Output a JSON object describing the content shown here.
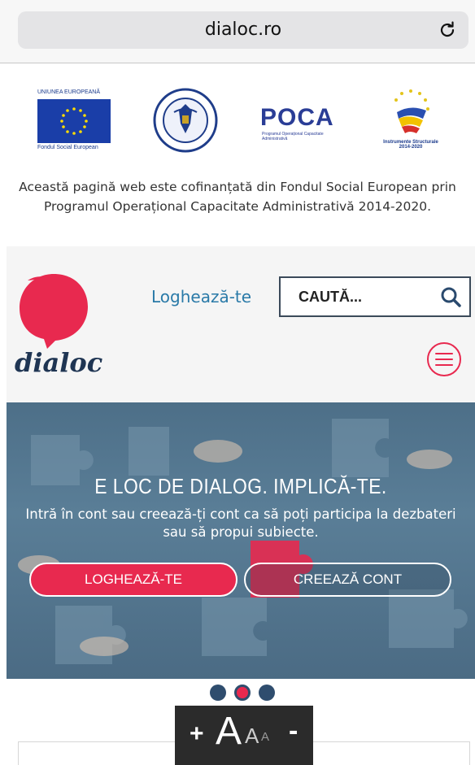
{
  "browser": {
    "url": "dialoc.ro",
    "reload_icon": "reload-icon"
  },
  "partners": {
    "eu_caption_top": "UNIUNEA EUROPEANĂ",
    "eu_caption_bottom": "Fondul Social European",
    "gov_ring_text": "GUVERNUL ROMÂNIEI",
    "poca_title": "POCA",
    "poca_subtitle": "Programul Operațional Capacitate Administrativă",
    "is_caption": "Instrumente Structurale 2014-2020",
    "cofinance_note": "Această pagină web este cofinanțată din Fondul Social European prin Programul Operațional Capacitate Administrativă 2014-2020."
  },
  "header": {
    "brand_text": "dialoc",
    "login_link": "Loghează-te",
    "search_placeholder": "CAUTĂ..."
  },
  "hero": {
    "title": "E LOC DE DIALOG. IMPLICĂ-TE.",
    "subtitle": "Intră în cont sau creează-ți cont ca să poți participa la dezbateri sau să propui subiecte.",
    "login_button": "LOGHEAZĂ-TE",
    "create_button": "CREEAZĂ CONT"
  },
  "carousel": {
    "slide_count": 3,
    "active_index": 1
  },
  "font_widget": {
    "plus": "+",
    "big": "A",
    "mid": "A",
    "small": "A",
    "minus": "-"
  },
  "colors": {
    "accent": "#e8294f",
    "link": "#2a7aa8",
    "hero_bg": "#4f7189",
    "dot": "#2f4d6e"
  }
}
